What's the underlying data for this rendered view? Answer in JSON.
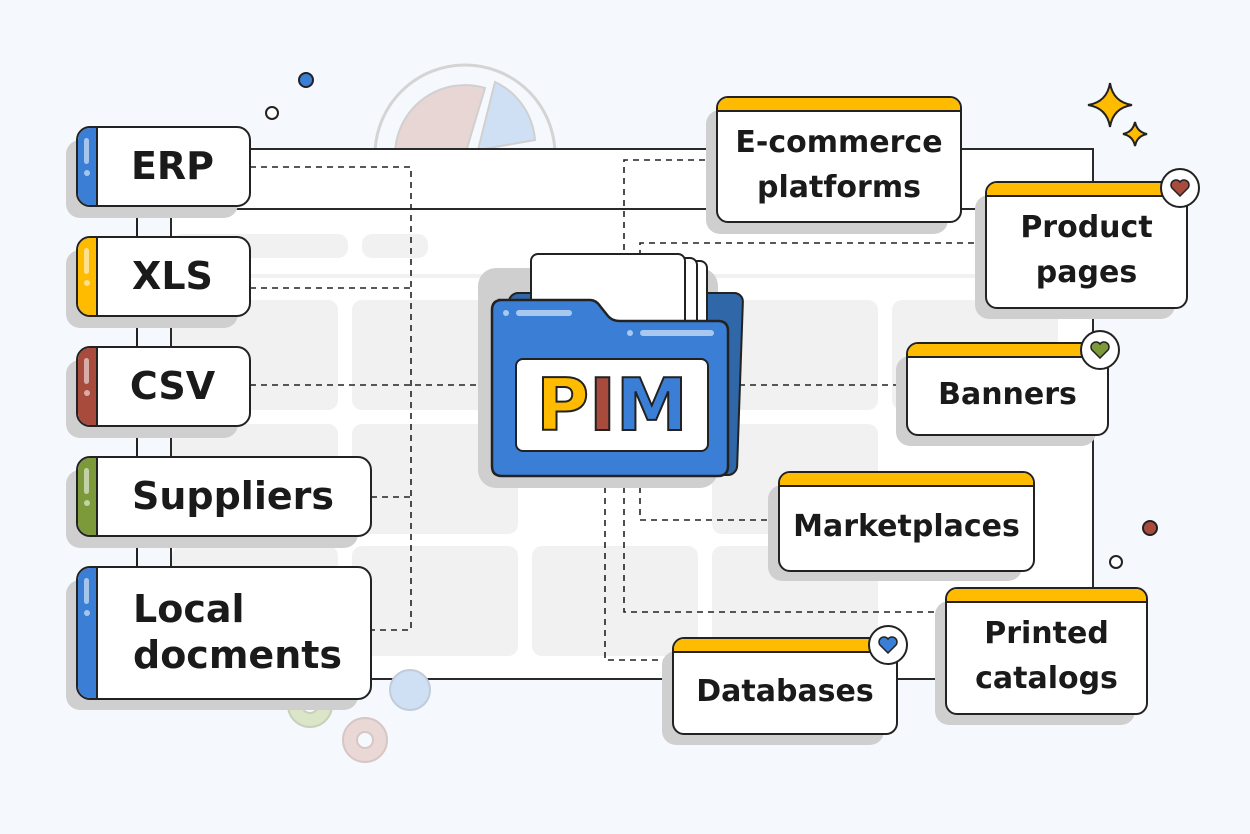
{
  "colors": {
    "blue": "#3a7fd5",
    "yellow": "#ffbb00",
    "red": "#a84a3c",
    "green": "#7d9a3a",
    "background": "#f5f8fd"
  },
  "center": {
    "label_p": "P",
    "label_i": "I",
    "label_m": "M"
  },
  "sources": [
    {
      "label": "ERP",
      "color": "#3a7fd5"
    },
    {
      "label": "XLS",
      "color": "#ffbb00"
    },
    {
      "label": "CSV",
      "color": "#a84a3c"
    },
    {
      "label": "Suppliers",
      "color": "#7d9a3a"
    },
    {
      "label": "Local docments",
      "color": "#3a7fd5"
    }
  ],
  "destinations": [
    {
      "label": "E-commerce platforms"
    },
    {
      "label": "Product pages",
      "badge": "heart-icon",
      "badge_color": "#a84a3c"
    },
    {
      "label": "Banners",
      "badge": "heart-icon",
      "badge_color": "#7d9a3a"
    },
    {
      "label": "Marketplaces"
    },
    {
      "label": "Printed catalogs"
    },
    {
      "label": "Databases",
      "badge": "heart-icon",
      "badge_color": "#3a7fd5"
    }
  ]
}
